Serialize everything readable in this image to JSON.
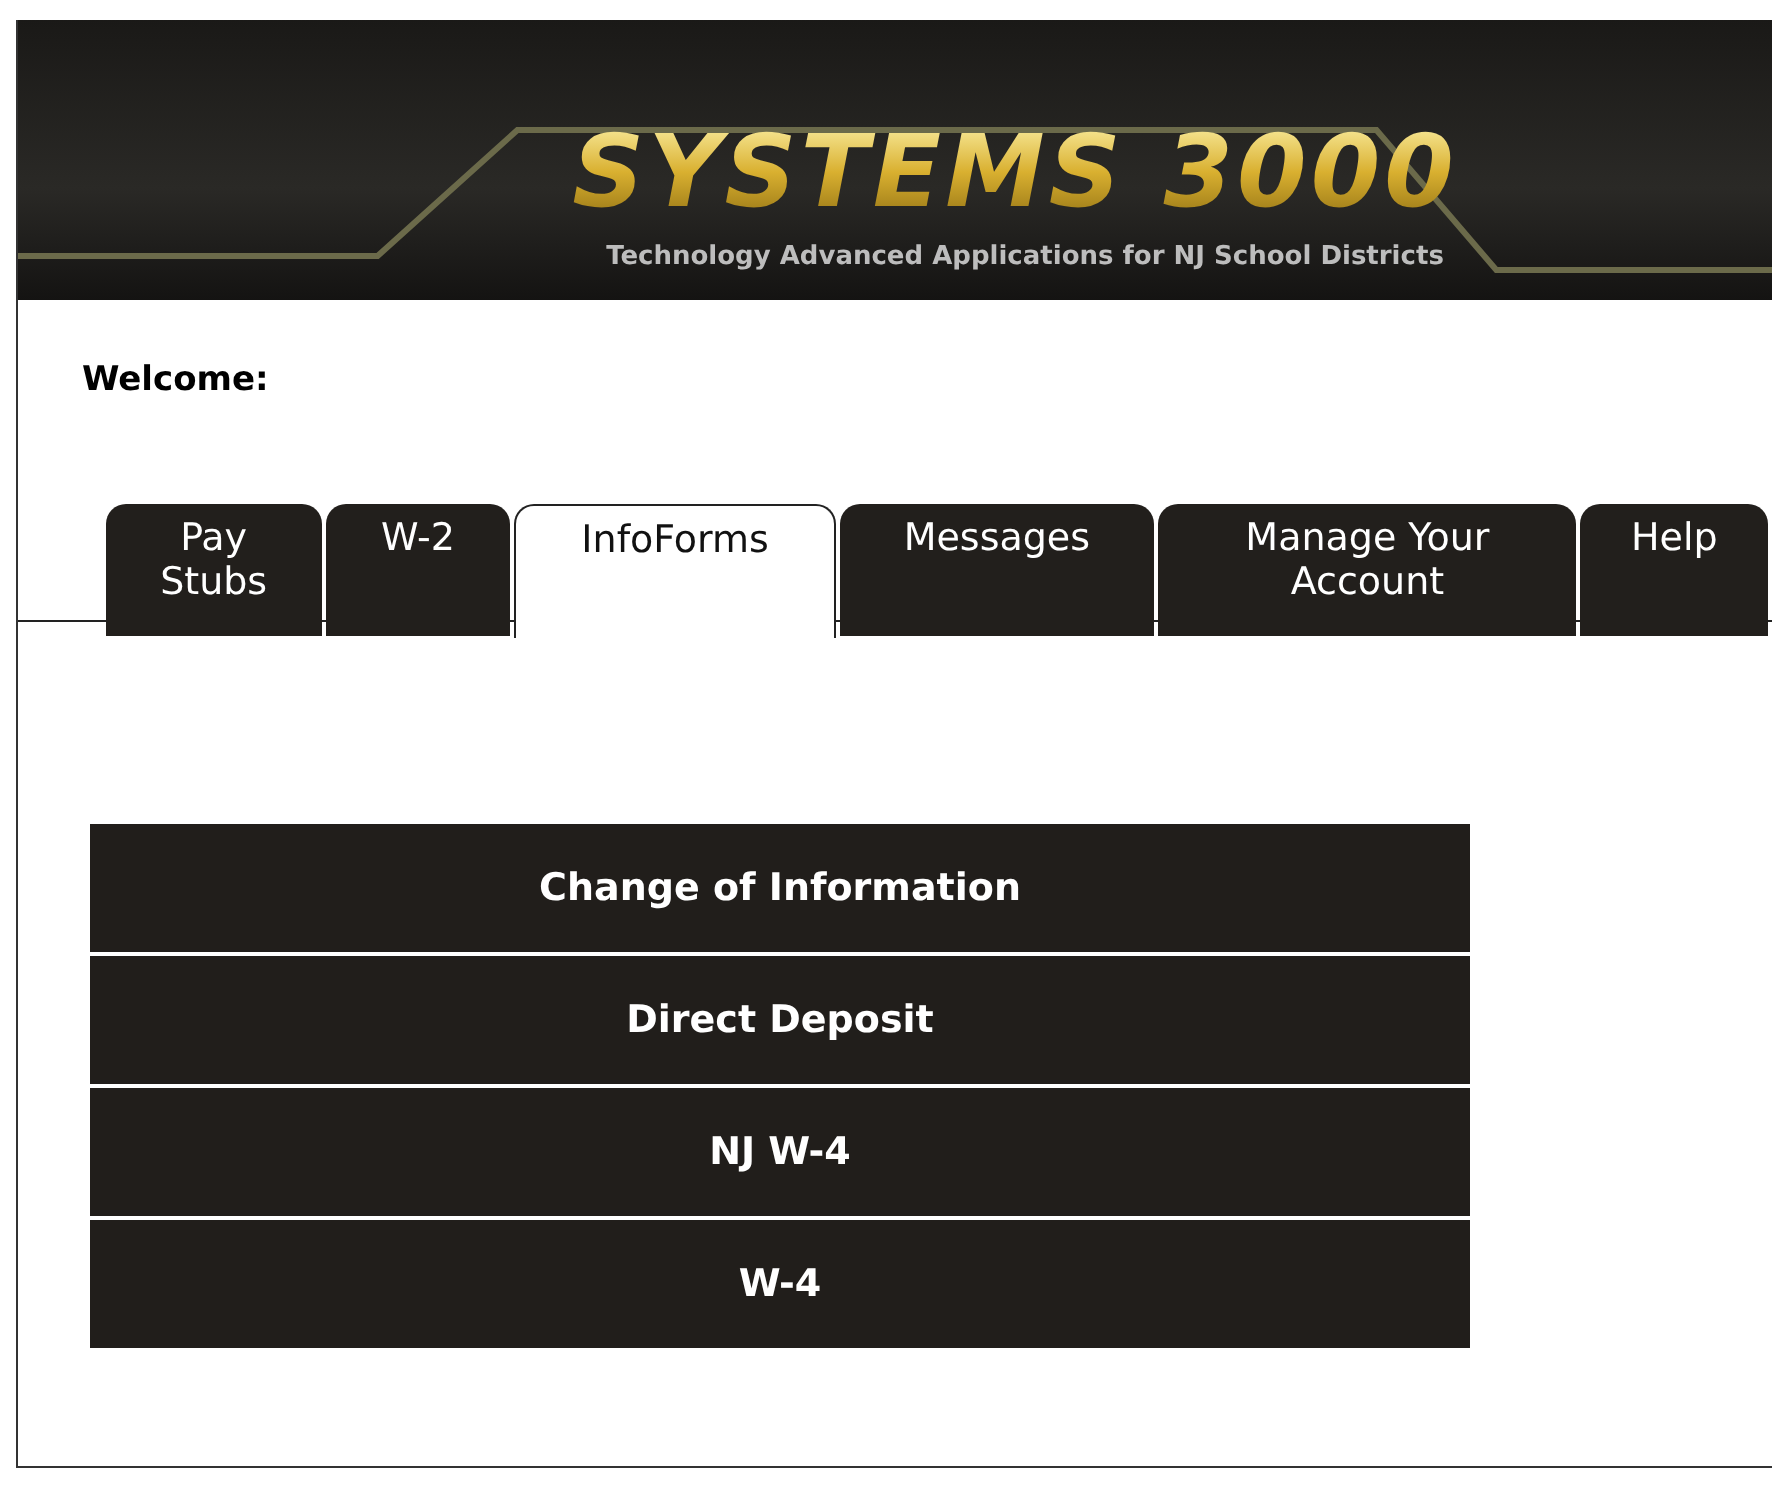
{
  "header": {
    "logo": "SYSTEMS 3000",
    "tagline": "Technology Advanced Applications for NJ School Districts"
  },
  "welcome": "Welcome:",
  "tabs": [
    {
      "label": "Pay Stubs",
      "selected": false
    },
    {
      "label": "W-2",
      "selected": false
    },
    {
      "label": "InfoForms",
      "selected": true
    },
    {
      "label": "Messages",
      "selected": false
    },
    {
      "label": "Manage Your Account",
      "selected": false
    },
    {
      "label": "Help",
      "selected": false
    }
  ],
  "menu": [
    "Change of Information",
    "Direct Deposit",
    "NJ W-4",
    "W-4"
  ]
}
